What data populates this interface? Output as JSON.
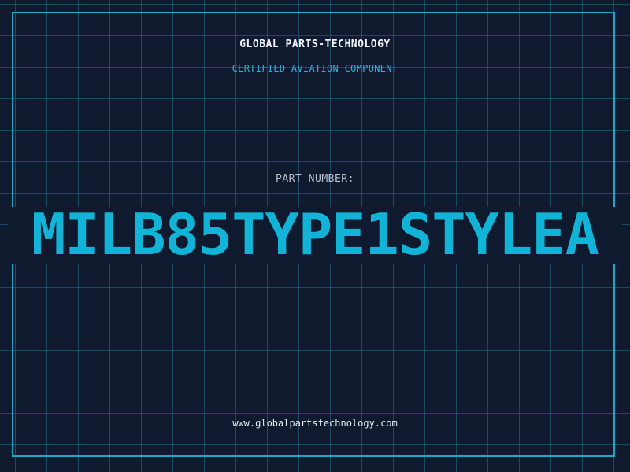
{
  "header": {
    "company": "GLOBAL PARTS-TECHNOLOGY",
    "subtitle": "CERTIFIED AVIATION COMPONENT"
  },
  "part": {
    "label": "PART NUMBER:",
    "number": "MILB85TYPE1STYLEA"
  },
  "footer": {
    "website": "www.globalpartstechnology.com"
  },
  "colors": {
    "background": "#101a2f",
    "grid": "#286e8c",
    "frame": "#1fa7c9",
    "accent": "#11b4d6",
    "text_primary": "#f2f5f8",
    "text_secondary": "#b9c3cf"
  }
}
